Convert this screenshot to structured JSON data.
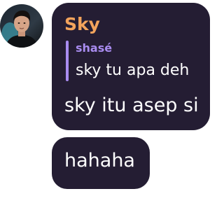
{
  "message": {
    "avatar_icon": "user-avatar-photo",
    "sender_name": "Sky",
    "sender_color": "#f2a35c",
    "bubble_color": "#241d33",
    "reply": {
      "author": "shasé",
      "author_color": "#a98cf0",
      "bar_color": "#a98cf0",
      "text": "sky tu apa deh"
    },
    "text": "sky itu asep si"
  },
  "followup": {
    "text": "hahaha"
  }
}
